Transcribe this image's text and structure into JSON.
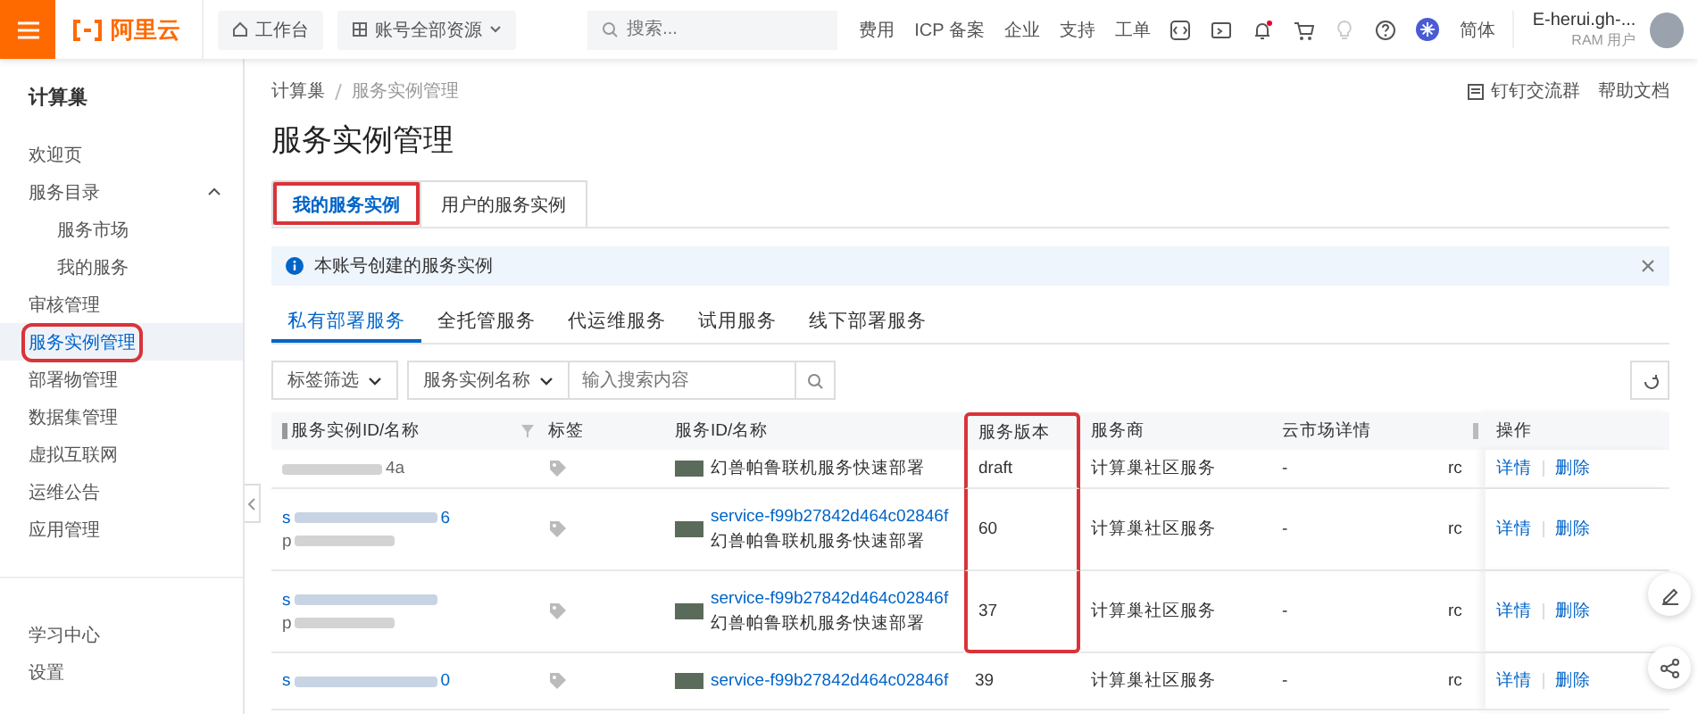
{
  "topbar": {
    "logo": "阿里云",
    "workbench": "工作台",
    "resources": "账号全部资源",
    "search": {
      "placeholder": "搜索..."
    },
    "links": [
      "费用",
      "ICP 备案",
      "企业",
      "支持",
      "工单"
    ],
    "notification_dot": true,
    "language": "简体",
    "user": {
      "name": "E-herui.gh-...",
      "role": "RAM 用户"
    }
  },
  "sidebar": {
    "title": "计算巢",
    "items": [
      {
        "label": "欢迎页",
        "selected": false,
        "annotated": false
      },
      {
        "label": "服务目录",
        "selected": false,
        "annotated": false,
        "expanded": true,
        "children": [
          {
            "label": "服务市场",
            "selected": false
          },
          {
            "label": "我的服务",
            "selected": false
          }
        ]
      },
      {
        "label": "审核管理",
        "selected": false,
        "annotated": false
      },
      {
        "label": "服务实例管理",
        "selected": true,
        "annotated": true
      },
      {
        "label": "部署物管理",
        "selected": false,
        "annotated": false
      },
      {
        "label": "数据集管理",
        "selected": false,
        "annotated": false
      },
      {
        "label": "虚拟互联网",
        "selected": false,
        "annotated": false
      },
      {
        "label": "运维公告",
        "selected": false,
        "annotated": false
      },
      {
        "label": "应用管理",
        "selected": false,
        "annotated": false
      }
    ],
    "footer_items": [
      {
        "label": "学习中心"
      },
      {
        "label": "设置"
      }
    ]
  },
  "main": {
    "breadcrumb": [
      "计算巢",
      "服务实例管理"
    ],
    "header_links": [
      {
        "label": "钉钉交流群",
        "kind": "group"
      },
      {
        "label": "帮助文档",
        "kind": "plain"
      }
    ],
    "title": "服务实例管理",
    "tabs": [
      {
        "label": "我的服务实例",
        "selected": true,
        "annotated": true
      },
      {
        "label": "用户的服务实例",
        "selected": false,
        "annotated": false
      }
    ],
    "notice": {
      "text": "本账号创建的服务实例"
    },
    "subtabs": [
      {
        "label": "私有部署服务",
        "selected": true
      },
      {
        "label": "全托管服务",
        "selected": false
      },
      {
        "label": "代运维服务",
        "selected": false
      },
      {
        "label": "试用服务",
        "selected": false
      },
      {
        "label": "线下部署服务",
        "selected": false
      }
    ],
    "filters": {
      "tag_filter": "标签筛选",
      "field": "服务实例名称",
      "placeholder": "输入搜索内容"
    },
    "table": {
      "columns": [
        {
          "label": "服务实例ID/名称",
          "highlighted": false
        },
        {
          "label": "标签",
          "highlighted": false
        },
        {
          "label": "服务ID/名称",
          "highlighted": false
        },
        {
          "label": "服务版本",
          "highlighted": true
        },
        {
          "label": "服务商",
          "highlighted": false
        },
        {
          "label": "云市场详情",
          "highlighted": false
        },
        {
          "label": "操作",
          "highlighted": false
        }
      ],
      "rows": [
        {
          "highlighted": true,
          "instance_name_tail": {
            "suffix": "4a"
          },
          "service_name": "幻兽帕鲁联机服务快速部署",
          "version": "draft",
          "provider": "计算巢社区服务",
          "market": "-",
          "column_7": "rc",
          "actions": [
            "详情",
            "删除"
          ]
        },
        {
          "highlighted": true,
          "instance_id": {
            "prefix": "s",
            "suffix": "6"
          },
          "instance_name": {
            "prefix": "p"
          },
          "service_id": "service-f99b27842d464c02846f",
          "service_name": "幻兽帕鲁联机服务快速部署",
          "version": "60",
          "provider": "计算巢社区服务",
          "market": "-",
          "column_7": "rc",
          "actions": [
            "详情",
            "删除"
          ]
        },
        {
          "highlighted": true,
          "instance_id": {
            "prefix": "s"
          },
          "instance_name": {
            "prefix": "p"
          },
          "service_id": "service-f99b27842d464c02846f",
          "service_name": "幻兽帕鲁联机服务快速部署",
          "version": "37",
          "provider": "计算巢社区服务",
          "market": "-",
          "column_7": "rc",
          "actions": [
            "详情",
            "删除"
          ]
        },
        {
          "highlighted": false,
          "instance_id": {
            "prefix": "s",
            "suffix": "0"
          },
          "service_id": "service-f99b27842d464c02846f",
          "version": "39",
          "provider": "计算巢社区服务",
          "market": "-",
          "column_7": "rc",
          "actions": [
            "详情",
            "删除"
          ]
        }
      ]
    }
  }
}
